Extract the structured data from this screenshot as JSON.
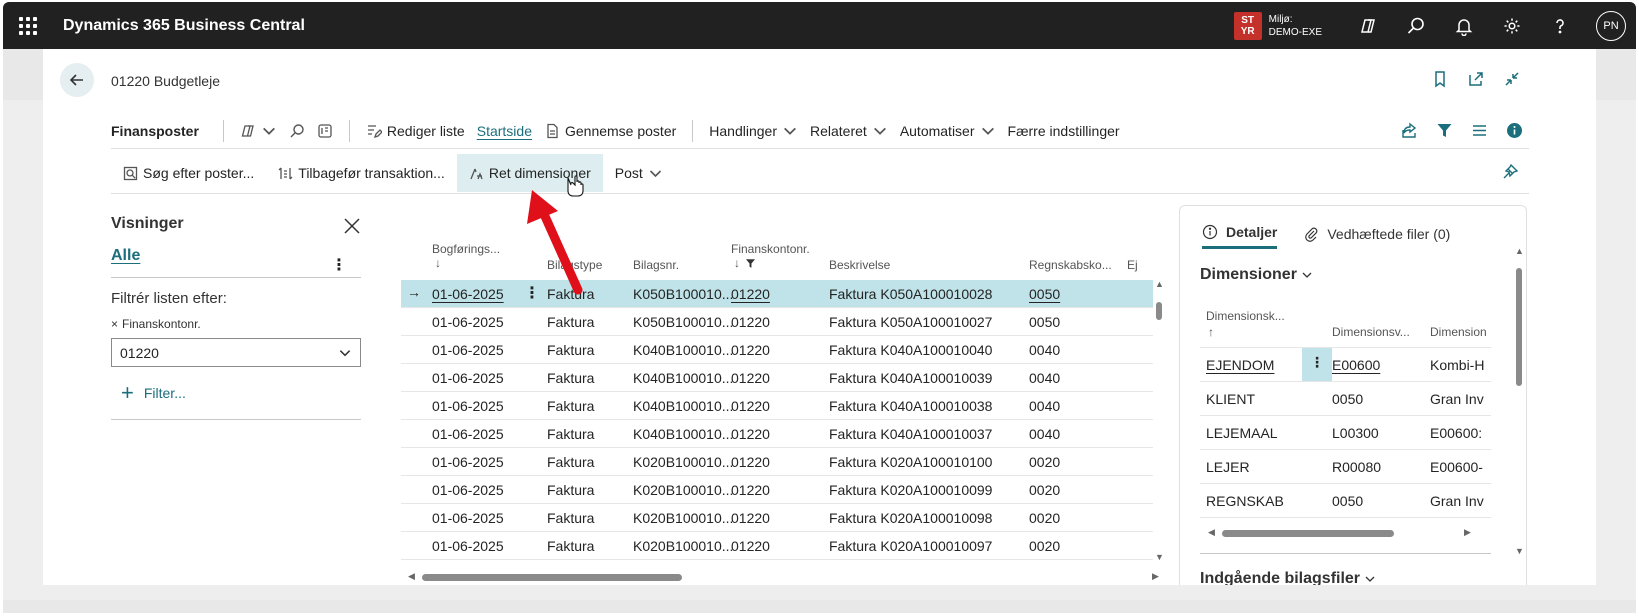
{
  "appbar": {
    "title": "Dynamics 365 Business Central",
    "env_badge": "ST YR",
    "env_label": "Miljø:",
    "env_name": "DEMO-EXE",
    "avatar_initials": "PN",
    "icons": [
      "copilot-icon",
      "search-icon",
      "bell-icon",
      "gear-icon",
      "help-icon"
    ]
  },
  "header": {
    "page_title": "01220 Budgetleje"
  },
  "actionbar": {
    "title": "Finansposter",
    "edit_list": "Rediger liste",
    "home": "Startside",
    "browse_entries": "Gennemse poster",
    "actions": "Handlinger",
    "related": "Relateret",
    "automate": "Automatiser",
    "fewer_options": "Færre indstillinger"
  },
  "actionbar2": {
    "find_entries": "Søg efter poster...",
    "reverse_transaction": "Tilbagefør transaktion...",
    "edit_dimensions": "Ret dimensioner",
    "post": "Post"
  },
  "views": {
    "title": "Visninger",
    "all": "Alle",
    "more": "⋮",
    "filter_title": "Filtrér listen efter:",
    "filter_field_label": "Finanskontonr.",
    "filter_value": "01220",
    "add_filter": "Filter..."
  },
  "grid": {
    "columns": {
      "posting_date": "Bogførings...",
      "posting_date_sort": "↓",
      "document_type": "Bilagstype",
      "document_no": "Bilagsnr.",
      "gl_account": "Finanskontonr.",
      "gl_account_sort": "↓",
      "description": "Beskrivelse",
      "accounting": "Regnskabsko...",
      "more": "Ej"
    },
    "rows": [
      {
        "date": "01-06-2025",
        "type": "Faktura",
        "doc": "K050B100010...",
        "account": "01220",
        "desc": "Faktura K050A100010028",
        "acc": "0050"
      },
      {
        "date": "01-06-2025",
        "type": "Faktura",
        "doc": "K050B100010...",
        "account": "01220",
        "desc": "Faktura K050A100010027",
        "acc": "0050"
      },
      {
        "date": "01-06-2025",
        "type": "Faktura",
        "doc": "K040B100010...",
        "account": "01220",
        "desc": "Faktura K040A100010040",
        "acc": "0040"
      },
      {
        "date": "01-06-2025",
        "type": "Faktura",
        "doc": "K040B100010...",
        "account": "01220",
        "desc": "Faktura K040A100010039",
        "acc": "0040"
      },
      {
        "date": "01-06-2025",
        "type": "Faktura",
        "doc": "K040B100010...",
        "account": "01220",
        "desc": "Faktura K040A100010038",
        "acc": "0040"
      },
      {
        "date": "01-06-2025",
        "type": "Faktura",
        "doc": "K040B100010...",
        "account": "01220",
        "desc": "Faktura K040A100010037",
        "acc": "0040"
      },
      {
        "date": "01-06-2025",
        "type": "Faktura",
        "doc": "K020B100010...",
        "account": "01220",
        "desc": "Faktura K020A100010100",
        "acc": "0020"
      },
      {
        "date": "01-06-2025",
        "type": "Faktura",
        "doc": "K020B100010...",
        "account": "01220",
        "desc": "Faktura K020A100010099",
        "acc": "0020"
      },
      {
        "date": "01-06-2025",
        "type": "Faktura",
        "doc": "K020B100010...",
        "account": "01220",
        "desc": "Faktura K020A100010098",
        "acc": "0020"
      },
      {
        "date": "01-06-2025",
        "type": "Faktura",
        "doc": "K020B100010...",
        "account": "01220",
        "desc": "Faktura K020A100010097",
        "acc": "0020"
      }
    ]
  },
  "details": {
    "tab_details": "Detaljer",
    "tab_attachments": "Vedhæftede filer (0)",
    "dimensions_title": "Dimensioner",
    "dim_columns": {
      "code": "Dimensionsk...",
      "code_sort": "↑",
      "value": "Dimensionsv...",
      "name": "Dimension"
    },
    "dim_rows": [
      {
        "code": "EJENDOM",
        "value": "E00600",
        "name": "Kombi-H"
      },
      {
        "code": "KLIENT",
        "value": "0050",
        "name": "Gran Inv"
      },
      {
        "code": "LEJEMAAL",
        "value": "L00300",
        "name": "E00600:"
      },
      {
        "code": "LEJER",
        "value": "R00080",
        "name": "E00600-"
      },
      {
        "code": "REGNSKAB",
        "value": "0050",
        "name": "Gran Inv"
      }
    ],
    "incoming_docs_title": "Indgående bilagsfiler"
  },
  "colors": {
    "accent": "#1b6e7c",
    "selected_row": "#bfe3e8",
    "appbar": "#212121",
    "env_badge": "#c4312b",
    "annotation_arrow": "#e0101a"
  }
}
